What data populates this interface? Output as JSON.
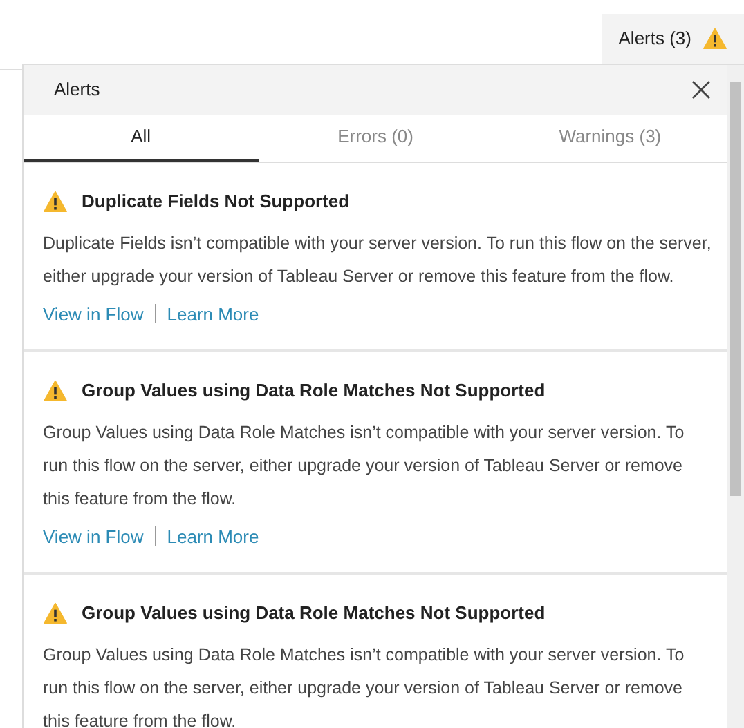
{
  "top_bar": {
    "alerts_button": "Alerts (3)"
  },
  "panel": {
    "title": "Alerts",
    "tabs": [
      {
        "label": "All",
        "selected": true
      },
      {
        "label": "Errors (0)",
        "selected": false
      },
      {
        "label": "Warnings (3)",
        "selected": false
      }
    ],
    "alerts": [
      {
        "kind": "warning",
        "title": "Duplicate Fields Not Supported",
        "message": "Duplicate Fields isn’t compatible with your server version. To run this flow on the server, either upgrade your version of Tableau Server or remove this feature from the flow.",
        "links": [
          "View in Flow",
          "Learn More"
        ]
      },
      {
        "kind": "warning",
        "title": "Group Values using Data Role Matches Not Supported",
        "message": "Group Values using Data Role Matches isn’t compatible with your server version. To run this flow on the server, either upgrade your version of Tableau Server or remove this feature from the flow.",
        "links": [
          "View in Flow",
          "Learn More"
        ]
      },
      {
        "kind": "warning",
        "title": "Group Values using Data Role Matches Not Supported",
        "message": "Group Values using Data Role Matches isn’t compatible with your server version. To run this flow on the server, either upgrade your version of Tableau Server or remove this feature from the flow."
      }
    ]
  }
}
